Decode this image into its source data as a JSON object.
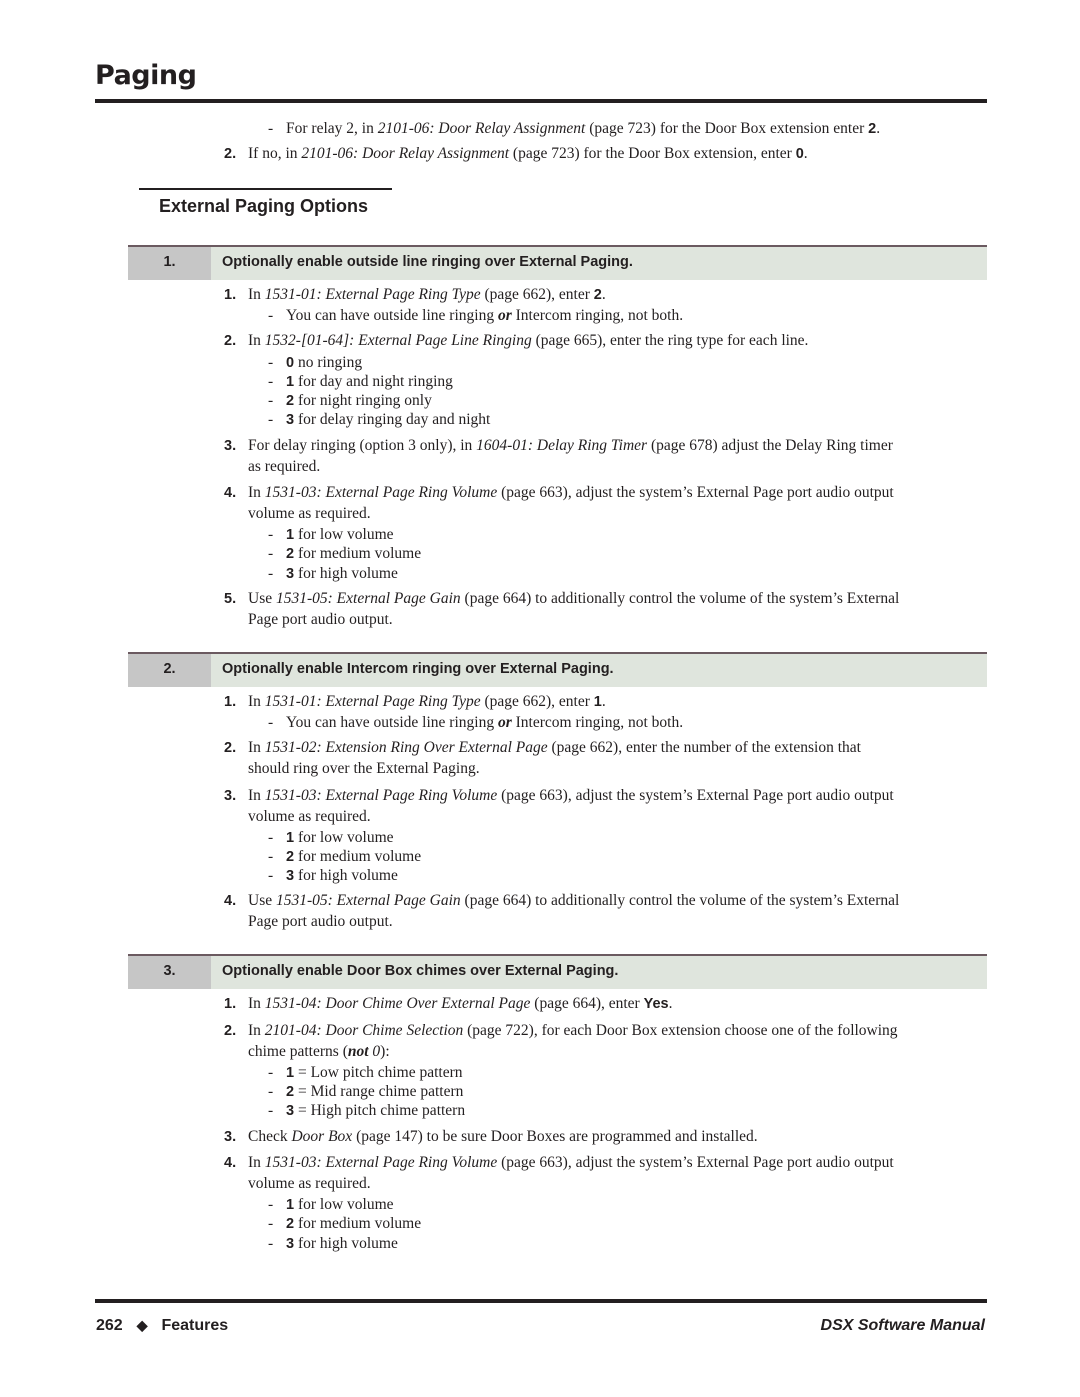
{
  "header": {
    "title": "Paging"
  },
  "intro": {
    "sub": {
      "pre": "For relay 2, in ",
      "ref": "2101-06: Door Relay Assignment",
      "post": " (page 723) for the Door Box extension enter ",
      "val": "2",
      "end": "."
    },
    "item2": {
      "num": "2.",
      "pre": "If no, in ",
      "ref": "2101-06: Door Relay Assignment",
      "post": " (page 723) for the Door Box extension, enter ",
      "val": "0",
      "end": "."
    }
  },
  "section": {
    "title": "External Paging Options"
  },
  "steps": [
    {
      "num": "1.",
      "title": "Optionally enable outside line ringing over External Paging.",
      "items": [
        {
          "num": "1.",
          "pre": "In ",
          "ref": "1531-01: External Page Ring Type",
          "post": " (page 662), enter ",
          "val": "2",
          "end": ".",
          "sub": {
            "pre": "You can have outside line ringing ",
            "em": "or",
            "post": " Intercom ringing, not both."
          }
        },
        {
          "num": "2.",
          "pre": "In ",
          "ref": "1532-[01-64]: External Page Line Ringing",
          "post": " (page 665), enter the ring type for each line.",
          "options": [
            {
              "val": "0",
              "text": " no ringing"
            },
            {
              "val": "1",
              "text": " for day and night ringing"
            },
            {
              "val": "2",
              "text": " for night ringing only"
            },
            {
              "val": "3",
              "text": " for delay ringing day and night"
            }
          ]
        },
        {
          "num": "3.",
          "pre": "For delay ringing (option 3 only), in ",
          "ref": "1604-01: Delay Ring Timer",
          "post": " (page 678) adjust the Delay Ring timer",
          "cont": "as required."
        },
        {
          "num": "4.",
          "pre": "In ",
          "ref": "1531-03: External Page Ring Volume",
          "post": " (page 663), adjust the system’s External Page port audio output",
          "cont": "volume as required.",
          "options": [
            {
              "val": "1",
              "text": " for low volume"
            },
            {
              "val": "2",
              "text": " for medium volume"
            },
            {
              "val": "3",
              "text": " for high volume"
            }
          ]
        },
        {
          "num": "5.",
          "pre": "Use ",
          "ref": "1531-05: External Page Gain",
          "post": " (page 664) to additionally control the volume of the system’s External",
          "cont": "Page port audio output."
        }
      ]
    },
    {
      "num": "2.",
      "title": "Optionally enable Intercom ringing over External Paging.",
      "items": [
        {
          "num": "1.",
          "pre": "In ",
          "ref": "1531-01: External Page Ring Type",
          "post": " (page 662), enter ",
          "val": "1",
          "end": ".",
          "sub": {
            "pre": "You can have outside line ringing ",
            "em": "or",
            "post": " Intercom ringing, not both."
          }
        },
        {
          "num": "2.",
          "pre": "In ",
          "ref": "1531-02: Extension Ring Over External Page",
          "post": " (page 662), enter the number of the extension that",
          "cont": "should ring over the External Paging."
        },
        {
          "num": "3.",
          "pre": "In ",
          "ref": "1531-03: External Page Ring Volume",
          "post": " (page 663), adjust the system’s External Page port audio output",
          "cont": "volume as required.",
          "options": [
            {
              "val": "1",
              "text": " for low volume"
            },
            {
              "val": "2",
              "text": " for medium volume"
            },
            {
              "val": "3",
              "text": " for high volume"
            }
          ]
        },
        {
          "num": "4.",
          "pre": "Use ",
          "ref": "1531-05: External Page Gain",
          "post": " (page 664) to additionally control the volume of the system’s External",
          "cont": "Page port audio output."
        }
      ]
    },
    {
      "num": "3.",
      "title": "Optionally enable Door Box chimes over External Paging.",
      "items": [
        {
          "num": "1.",
          "pre": "In ",
          "ref": "1531-04: Door Chime Over External Page",
          "post": " (page 664), enter ",
          "val": "Yes",
          "end": "."
        },
        {
          "num": "2.",
          "pre": "In ",
          "ref": "2101-04: Door Chime Selection",
          "post": " (page 722), for each Door Box extension choose one of the following",
          "cont_pre": "chime patterns (",
          "cont_em": "not",
          "cont_it": " 0",
          "cont_end": "):",
          "options": [
            {
              "val": "1",
              "text": " = Low pitch chime pattern"
            },
            {
              "val": "2",
              "text": " = Mid range chime pattern"
            },
            {
              "val": "3",
              "text": " = High pitch chime pattern"
            }
          ]
        },
        {
          "num": "3.",
          "pre": "Check ",
          "ref": "Door Box",
          "post": " (page 147) to be sure Door Boxes are programmed and installed."
        },
        {
          "num": "4.",
          "pre": "In ",
          "ref": "1531-03: External Page Ring Volume",
          "post": " (page 663), adjust the system’s External Page port audio output",
          "cont": "volume as required.",
          "options": [
            {
              "val": "1",
              "text": " for low volume"
            },
            {
              "val": "2",
              "text": " for medium volume"
            },
            {
              "val": "3",
              "text": " for high volume"
            }
          ]
        }
      ]
    }
  ],
  "footer": {
    "page_number": "262",
    "diamond": "◆",
    "section": "Features",
    "manual": "DSX Software Manual"
  },
  "colors": {
    "text": "#231f20",
    "step_bar": "#dfe5dd",
    "step_num_bg": "#c6c6c6",
    "step_rule": "#6b5a60"
  }
}
